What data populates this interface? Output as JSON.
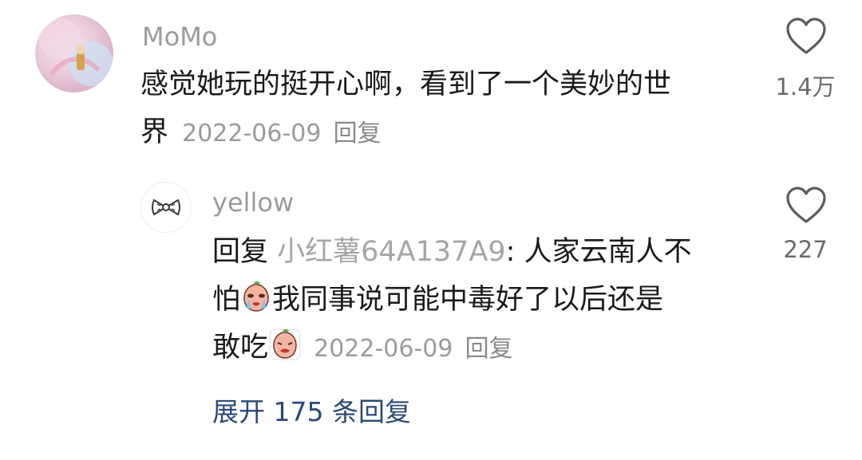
{
  "comment": {
    "username": "MoMo",
    "text_line1": "感觉她玩的挺开心啊，看到了一个美妙的世",
    "text_line2": "界",
    "date": "2022-06-09",
    "reply_label": "回复",
    "like_count": "1.4万"
  },
  "reply": {
    "username": "yellow",
    "prefix": "回复",
    "quoted_user": "小红薯64A137A9",
    "text_line1_tail": ": 人家云南人不",
    "text_line2_head": "怕",
    "text_line2_tail": "我同事说可能中毒好了以后还是",
    "text_line3": "敢吃",
    "date": "2022-06-09",
    "reply_label": "回复",
    "like_count": "227"
  },
  "expand": {
    "label": "展开 175 条回复"
  },
  "icons": {
    "comment_like": "heart-outline-icon",
    "reply_like": "heart-outline-icon",
    "reply_avatar": "bow-icon",
    "emoji_1": "crying-emoji-icon",
    "emoji_2": "sad-emoji-icon"
  }
}
